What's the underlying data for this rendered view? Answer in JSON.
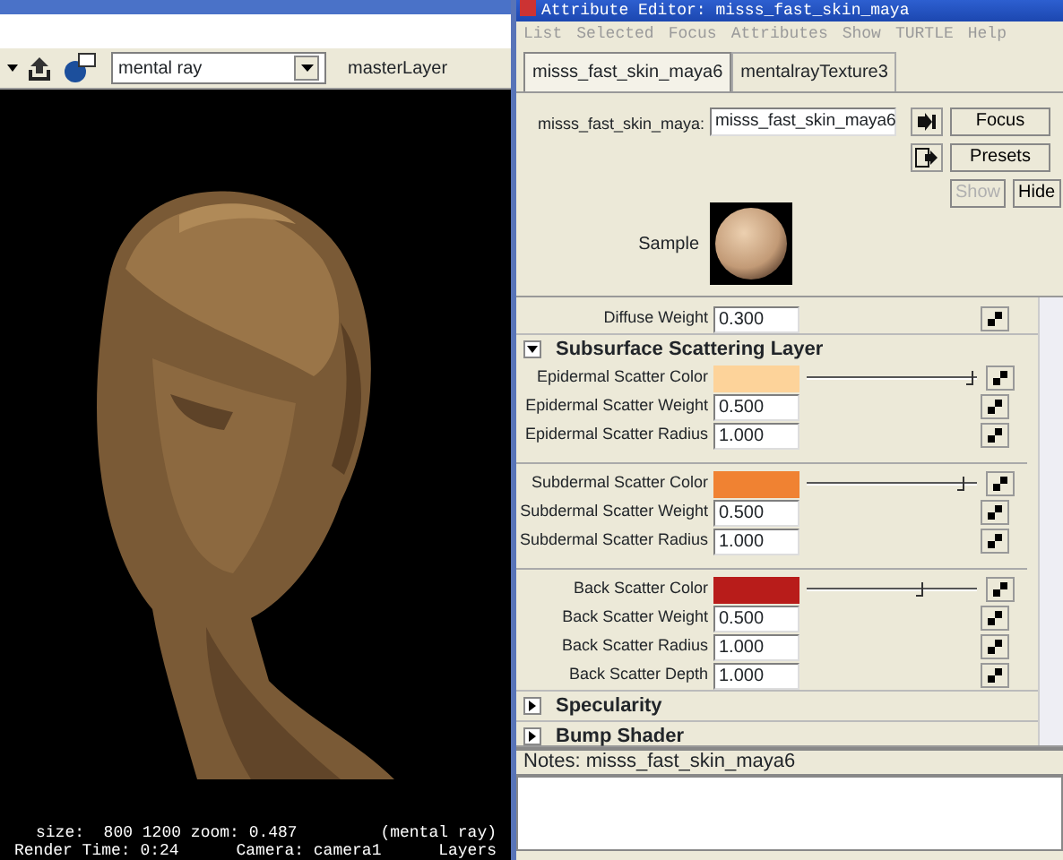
{
  "render_view": {
    "toolbar": {
      "renderer": "mental ray",
      "layer": "masterLayer"
    },
    "status": [
      {
        "left": "size:  800 1200 zoom: 0.487",
        "right": "(mental ray)"
      },
      {
        "left": "Render Time: 0:24",
        "middle": "Camera: camera1",
        "right": "Layers"
      }
    ]
  },
  "attribute_editor": {
    "title": "Attribute Editor: misss_fast_skin_maya",
    "menu": [
      "List",
      "Selected",
      "Focus",
      "Attributes",
      "Show",
      "TURTLE",
      "Help"
    ],
    "tabs": [
      {
        "label": "misss_fast_skin_maya6",
        "selected": true
      },
      {
        "label": "mentalrayTexture3",
        "selected": false
      }
    ],
    "node_label": "misss_fast_skin_maya:",
    "node_value": "misss_fast_skin_maya6",
    "buttons": [
      {
        "label": "Focus",
        "disabled": false
      },
      {
        "label": "Presets",
        "disabled": false
      },
      {
        "label": "Show",
        "disabled": true
      },
      {
        "label": "Hide",
        "disabled": false
      }
    ],
    "sample_label": "Sample",
    "rows": [
      {
        "kind": "field",
        "label": "Diffuse Weight",
        "value": "0.300"
      },
      {
        "kind": "section",
        "label": "Subsurface Scattering Layer",
        "expanded": true
      },
      {
        "kind": "color",
        "label": "Epidermal Scatter Color",
        "color": "#fdd39a",
        "level": 0.98
      },
      {
        "kind": "field",
        "label": "Epidermal Scatter Weight",
        "value": "0.500"
      },
      {
        "kind": "field",
        "label": "Epidermal Scatter Radius",
        "value": "1.000"
      },
      {
        "kind": "divider"
      },
      {
        "kind": "color",
        "label": "Subdermal Scatter Color",
        "color": "#f08232",
        "level": 0.93
      },
      {
        "kind": "field",
        "label": "Subdermal Scatter Weight",
        "value": "0.500"
      },
      {
        "kind": "field",
        "label": "Subdermal Scatter Radius",
        "value": "1.000"
      },
      {
        "kind": "divider"
      },
      {
        "kind": "color",
        "label": "Back Scatter Color",
        "color": "#b81c1a",
        "level": 0.68
      },
      {
        "kind": "field",
        "label": "Back Scatter Weight",
        "value": "0.500"
      },
      {
        "kind": "field",
        "label": "Back Scatter Radius",
        "value": "1.000"
      },
      {
        "kind": "field",
        "label": "Back Scatter Depth",
        "value": "1.000"
      },
      {
        "kind": "section",
        "label": "Specularity",
        "expanded": false
      },
      {
        "kind": "section",
        "label": "Bump Shader",
        "expanded": false
      }
    ],
    "notes_title": "Notes:  misss_fast_skin_maya6"
  }
}
